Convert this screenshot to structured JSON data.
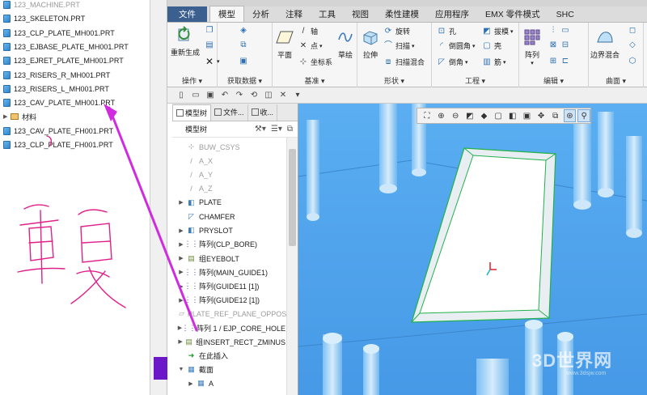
{
  "file_list": {
    "items": [
      {
        "name": "123_MACHINE.PRT",
        "faded": true
      },
      {
        "name": "123_SKELETON.PRT"
      },
      {
        "name": "123_CLP_PLATE_MH001.PRT"
      },
      {
        "name": "123_EJBASE_PLATE_MH001.PRT"
      },
      {
        "name": "123_EJRET_PLATE_MH001.PRT"
      },
      {
        "name": "123_RISERS_R_MH001.PRT"
      },
      {
        "name": "123_RISERS_L_MH001.PRT"
      },
      {
        "name": "123_CAV_PLATE_MH001.PRT"
      },
      {
        "name": "材料",
        "folder": true
      },
      {
        "name": "123_CAV_PLATE_FH001.PRT"
      },
      {
        "name": "123_CLP_PLATE_FH001.PRT"
      }
    ]
  },
  "ribbon": {
    "tabs": [
      "文件",
      "模型",
      "分析",
      "注释",
      "工具",
      "视图",
      "柔性建模",
      "应用程序",
      "EMX 零件模式",
      "SHC"
    ],
    "active_tab": "模型",
    "groups": {
      "operations": {
        "label": "操作",
        "regenerate": "重新生成"
      },
      "get_data": {
        "label": "获取数据"
      },
      "datum": {
        "label": "基准",
        "plane": "平面",
        "axis": "轴",
        "point": "点",
        "csys": "坐标系",
        "sketch": "草绘"
      },
      "shapes": {
        "label": "形状",
        "extrude": "拉伸",
        "revolve": "旋转",
        "sweep": "扫描",
        "swept_blend": "扫描混合"
      },
      "engineering": {
        "label": "工程",
        "hole": "孔",
        "round": "倒圆角",
        "chamfer": "倒角",
        "draft": "拔模",
        "shell": "壳",
        "rib": "筋"
      },
      "editing": {
        "label": "编辑",
        "pattern": "阵列"
      },
      "surfaces": {
        "label": "曲面",
        "boundary_blend": "边界混合"
      }
    }
  },
  "tree_panel": {
    "tabs": [
      "模型树",
      "文件...",
      "收..."
    ],
    "header": "模型树",
    "items": [
      {
        "label": "BUW_CSYS",
        "faded": true,
        "icon": "csys-icon"
      },
      {
        "label": "A_X",
        "faded": true,
        "icon": "axis-icon"
      },
      {
        "label": "A_Y",
        "faded": true,
        "icon": "axis-icon"
      },
      {
        "label": "A_Z",
        "faded": true,
        "icon": "axis-icon"
      },
      {
        "label": "PLATE",
        "expand": true,
        "icon": "extrude-icon"
      },
      {
        "label": "CHAMFER",
        "icon": "chamfer-icon"
      },
      {
        "label": "PRYSLOT",
        "expand": true,
        "icon": "extrude-icon"
      },
      {
        "label": "阵列(CLP_BORE)",
        "expand": true,
        "icon": "pattern-icon"
      },
      {
        "label": "组EYEBOLT",
        "expand": true,
        "icon": "group-icon"
      },
      {
        "label": "阵列(MAIN_GUIDE1)",
        "expand": true,
        "icon": "pattern-icon"
      },
      {
        "label": "阵列(GUIDE11 [1])",
        "expand": true,
        "icon": "pattern-icon"
      },
      {
        "label": "阵列(GUIDE12 [1])",
        "expand": true,
        "icon": "pattern-icon"
      },
      {
        "label": "PLATE_REF_PLANE_OPPOS",
        "faded": true,
        "icon": "plane-icon"
      },
      {
        "label": "阵列 1 / EJP_CORE_HOLE",
        "expand": true,
        "icon": "pattern-icon"
      },
      {
        "label": "组INSERT_RECT_ZMINUS",
        "expand": true,
        "icon": "group-icon"
      },
      {
        "label": "在此插入",
        "icon": "insert-here-icon"
      },
      {
        "label": "截面",
        "expand": true,
        "expanded": true,
        "icon": "section-icon"
      },
      {
        "label": "A",
        "expand": true,
        "indent": true,
        "icon": "section-icon"
      }
    ]
  },
  "annotation": {
    "handwritten_text": "重复"
  },
  "watermark": {
    "text": "3D世界网",
    "sub": "www.3dsjw.com"
  },
  "colors": {
    "viewport": "#4da3ee",
    "annotation": "#e0218a",
    "arrow": "#d02be0",
    "file_tab": "#3b5f8f"
  }
}
